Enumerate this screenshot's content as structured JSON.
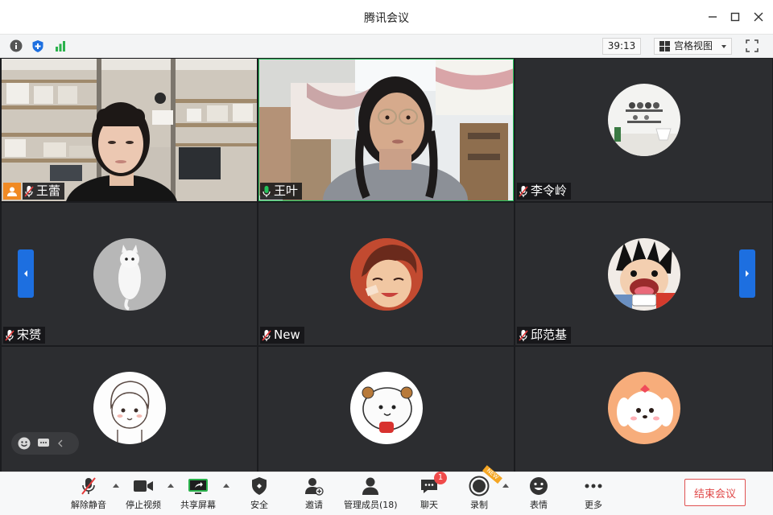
{
  "window": {
    "title": "腾讯会议"
  },
  "infobar": {
    "timer": "39:13",
    "view_mode": "宫格视图"
  },
  "participants": [
    {
      "name": "王蕾",
      "mic": "muted",
      "type": "video"
    },
    {
      "name": "王叶",
      "mic": "active",
      "type": "video"
    },
    {
      "name": "李令岭",
      "mic": "muted",
      "type": "avatar"
    },
    {
      "name": "宋赟",
      "mic": "muted",
      "type": "avatar"
    },
    {
      "name": "New",
      "mic": "muted",
      "type": "avatar"
    },
    {
      "name": "邱范基",
      "mic": "muted",
      "type": "avatar"
    },
    {
      "name": "",
      "type": "avatar"
    },
    {
      "name": "",
      "type": "avatar"
    },
    {
      "name": "",
      "type": "avatar"
    }
  ],
  "toolbar": {
    "unmute": "解除静音",
    "stop_video": "停止视频",
    "share_screen": "共享屏幕",
    "security": "安全",
    "invite": "邀请",
    "manage_members": "管理成员(18)",
    "chat": "聊天",
    "chat_badge": "1",
    "record": "录制",
    "new_flag": "NEW",
    "reactions": "表情",
    "more": "更多",
    "end_meeting": "结束会议"
  },
  "colors": {
    "accent_blue": "#1d6fe0",
    "active_green": "#23c25a",
    "end_red": "#e04848",
    "badge_red": "#f04b4b",
    "tile_bg": "#2c2d30"
  }
}
